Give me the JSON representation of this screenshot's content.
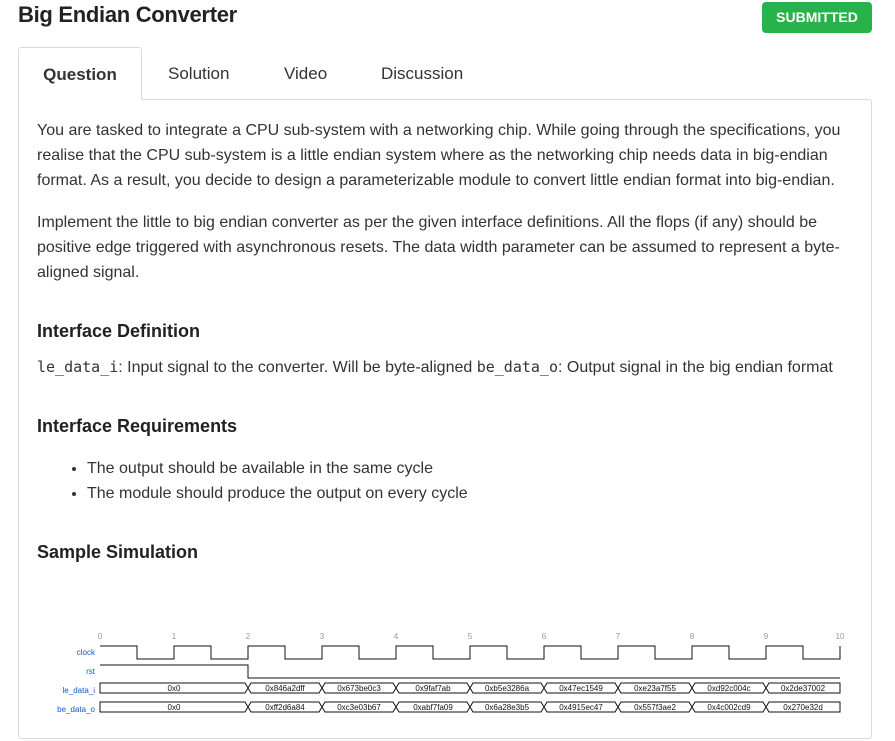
{
  "page": {
    "title": "Big Endian Converter",
    "status_badge": "SUBMITTED"
  },
  "tabs": [
    {
      "label": "Question",
      "active": true
    },
    {
      "label": "Solution",
      "active": false
    },
    {
      "label": "Video",
      "active": false
    },
    {
      "label": "Discussion",
      "active": false
    }
  ],
  "question": {
    "paragraph_1": "You are tasked to integrate a CPU sub-system with a networking chip. While going through the specifications, you realise that the CPU sub-system is a little endian system where as the networking chip needs data in big-endian format. As a result, you decide to design a parameterizable module to convert little endian format into big-endian.",
    "paragraph_2": "Implement the little to big endian converter as per the given interface definitions. All the flops (if any) should be positive edge triggered with asynchronous resets. The data width parameter can be assumed to represent a byte-aligned signal.",
    "interface_definition": {
      "heading": "Interface Definition",
      "le_signal": "le_data_i",
      "le_desc": ": Input signal to the converter. Will be byte-aligned ",
      "be_signal": "be_data_o",
      "be_desc": ": Output signal in the big endian format"
    },
    "interface_requirements": {
      "heading": "Interface Requirements",
      "items": [
        "The output should be available in the same cycle",
        "The module should produce the output on every cycle"
      ]
    },
    "sample_simulation": {
      "heading": "Sample Simulation",
      "time_ticks": [
        "0",
        "1",
        "2",
        "3",
        "4",
        "5",
        "6",
        "7",
        "8",
        "9",
        "10"
      ],
      "signals": {
        "clock": "clock",
        "rst": "rst",
        "le_data_i": "le_data_i",
        "be_data_o": "be_data_o"
      },
      "le_values": [
        "0x0",
        "0x846a2dff",
        "0x673be0c3",
        "0x9faf7ab",
        "0xb5e3286a",
        "0x47ec1549",
        "0xe23a7f55",
        "0xd92c004c",
        "0x2de37002"
      ],
      "be_values": [
        "0x0",
        "0xff2d6a84",
        "0xc3e03b67",
        "0xabf7fa09",
        "0x6a28e3b5",
        "0x4915ec47",
        "0x557f3ae2",
        "0x4c002cd9",
        "0x270e32d"
      ],
      "rst_high_until_cycle": 2,
      "colors": {
        "label_blue": "#1a56c9",
        "wave_black": "#111111",
        "tick_gray": "#999999"
      }
    }
  }
}
